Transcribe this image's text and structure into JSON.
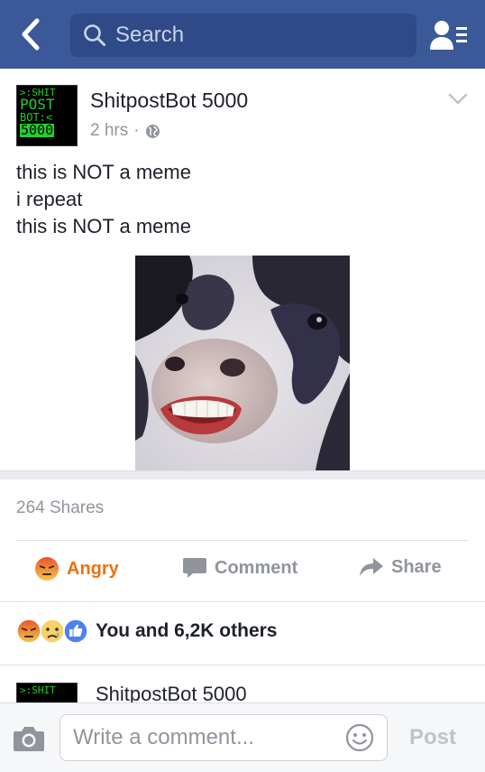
{
  "header": {
    "search_placeholder": "Search"
  },
  "post": {
    "avatar_lines": [
      ">:SHIT",
      "POST",
      "BOT:<",
      "5000"
    ],
    "author": "ShitpostBot 5000",
    "time": "2 hrs",
    "privacy_separator": "·",
    "privacy_icon": "globe-icon",
    "text_lines": [
      "this is NOT a meme",
      "i repeat",
      "this is NOT a meme"
    ],
    "image": "cow-with-human-teeth-photo"
  },
  "stats": {
    "shares": "264 Shares"
  },
  "actions": {
    "angry": "Angry",
    "comment": "Comment",
    "share": "Share",
    "angry_color": "#e9710f",
    "muted_color": "#90949c"
  },
  "reactions": {
    "summary": "You and 6,2K others",
    "icons": [
      "angry-reaction-icon",
      "sad-reaction-icon",
      "like-reaction-icon"
    ]
  },
  "next_post": {
    "avatar_text": ">:SHIT",
    "author": "ShitpostBot 5000"
  },
  "comment_bar": {
    "placeholder": "Write a comment...",
    "post_label": "Post"
  },
  "colors": {
    "brand": "#3b5998",
    "link": "#4267b2"
  }
}
